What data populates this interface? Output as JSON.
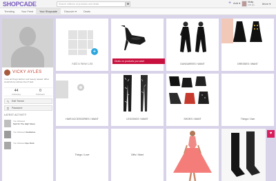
{
  "header": {
    "logo": "SHOPCADE",
    "search_placeholder": "Search millions of products and deals",
    "add_label": "Add",
    "user_name": "Vicky",
    "user_sub": "109 pts",
    "more_label": "More"
  },
  "nav": {
    "tabs": [
      "Trending",
      "Your Feed",
      "Your Shopcade",
      "Discover",
      "Deals"
    ],
    "active_index": 2
  },
  "profile": {
    "name": "VICKY AYLES",
    "bio": "I love all things fashion and beauty related. What would life be without them? Eat!",
    "following_count": "44",
    "following_label": "Following",
    "followers_count": "0",
    "followers_label": "Followers",
    "edit_button": "Edit Theme",
    "password_button": "Password",
    "activity_title": "LATEST ACTIVITY",
    "activity": [
      {
        "prefix": "You followed",
        "name": "Nail On The High Street"
      },
      {
        "prefix": "You followed",
        "name": "Vestidazos"
      },
      {
        "prefix": "You followed",
        "name": "Eye Rock"
      }
    ]
  },
  "tiles": {
    "new_list": "Add a New List",
    "deals_bar": "Deals on products you want",
    "lists": [
      "DUNGAREES I WANT",
      "DRESSES I WANT",
      "HAIR ACCESSORIES I WANT",
      "LEGGINGS I WANT",
      "SHOES I WANT",
      "Things I Own",
      "Things I Love",
      "Gifts I Want"
    ]
  },
  "colors": {
    "accent": "#7a5cc0",
    "deals": "#c8103e",
    "plus": "#2ba6de",
    "name": "#c0392b",
    "background": "#d9d3ea"
  }
}
